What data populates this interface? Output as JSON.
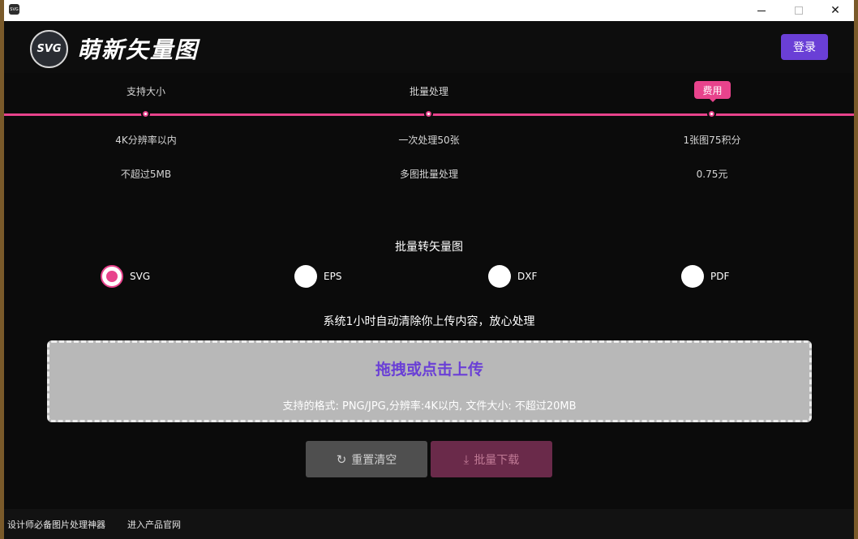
{
  "titlebar": {
    "app_icon_label": "SVG",
    "minimize_icon": "minimize-icon",
    "maximize_icon": "maximize-icon",
    "close_label": "✕"
  },
  "header": {
    "logo_mark": "SVG",
    "app_name": "萌新矢量图",
    "login_label": "登录"
  },
  "info": {
    "columns": [
      {
        "heading": "支持大小",
        "row1": "4K分辨率以内",
        "row2": "不超过5MB"
      },
      {
        "heading": "批量处理",
        "row1": "一次处理50张",
        "row2": "多图批量处理"
      },
      {
        "heading": "费用",
        "row1": "1张图75积分",
        "row2": "0.75元"
      }
    ]
  },
  "convert": {
    "title": "批量转矢量图",
    "formats": [
      {
        "label": "SVG",
        "checked": true
      },
      {
        "label": "EPS",
        "checked": false
      },
      {
        "label": "DXF",
        "checked": false
      },
      {
        "label": "PDF",
        "checked": false
      }
    ],
    "notice": "系统1小时自动清除你上传内容，放心处理"
  },
  "upload": {
    "title": "拖拽或点击上传",
    "subtitle": "支持的格式: PNG/JPG,分辨率:4K以内, 文件大小: 不超过20MB"
  },
  "actions": {
    "reset_label": "重置清空",
    "reset_icon": "↻",
    "download_label": "批量下载",
    "download_icon": "⤓"
  },
  "footer": {
    "link1": "设计师必备图片处理神器",
    "link2": "进入产品官网"
  },
  "colors": {
    "accent_pink": "#e8438c",
    "accent_purple": "#6a3fd6",
    "background": "#0b0b0b"
  }
}
